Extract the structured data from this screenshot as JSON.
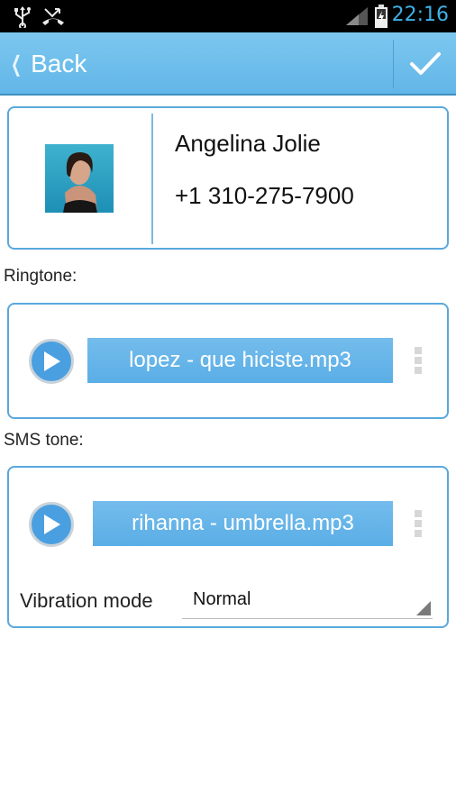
{
  "status_bar": {
    "time": "22:16",
    "icons": [
      "usb-icon",
      "missed-call-icon",
      "signal-icon",
      "battery-charging-icon"
    ]
  },
  "action_bar": {
    "back_label": "Back",
    "confirm_icon": "checkmark-icon"
  },
  "contact": {
    "name": "Angelina Jolie",
    "phone": "+1 310-275-7900"
  },
  "ringtone": {
    "section_label": "Ringtone:",
    "file": "lopez - que hiciste.mp3"
  },
  "sms": {
    "section_label": "SMS tone:",
    "file": "rihanna - umbrella.mp3",
    "vibration_label": "Vibration mode",
    "vibration_value": "Normal"
  },
  "colors": {
    "accent": "#5aa8dd",
    "action_bar": "#6bbbea",
    "clock": "#3fb1e6"
  }
}
